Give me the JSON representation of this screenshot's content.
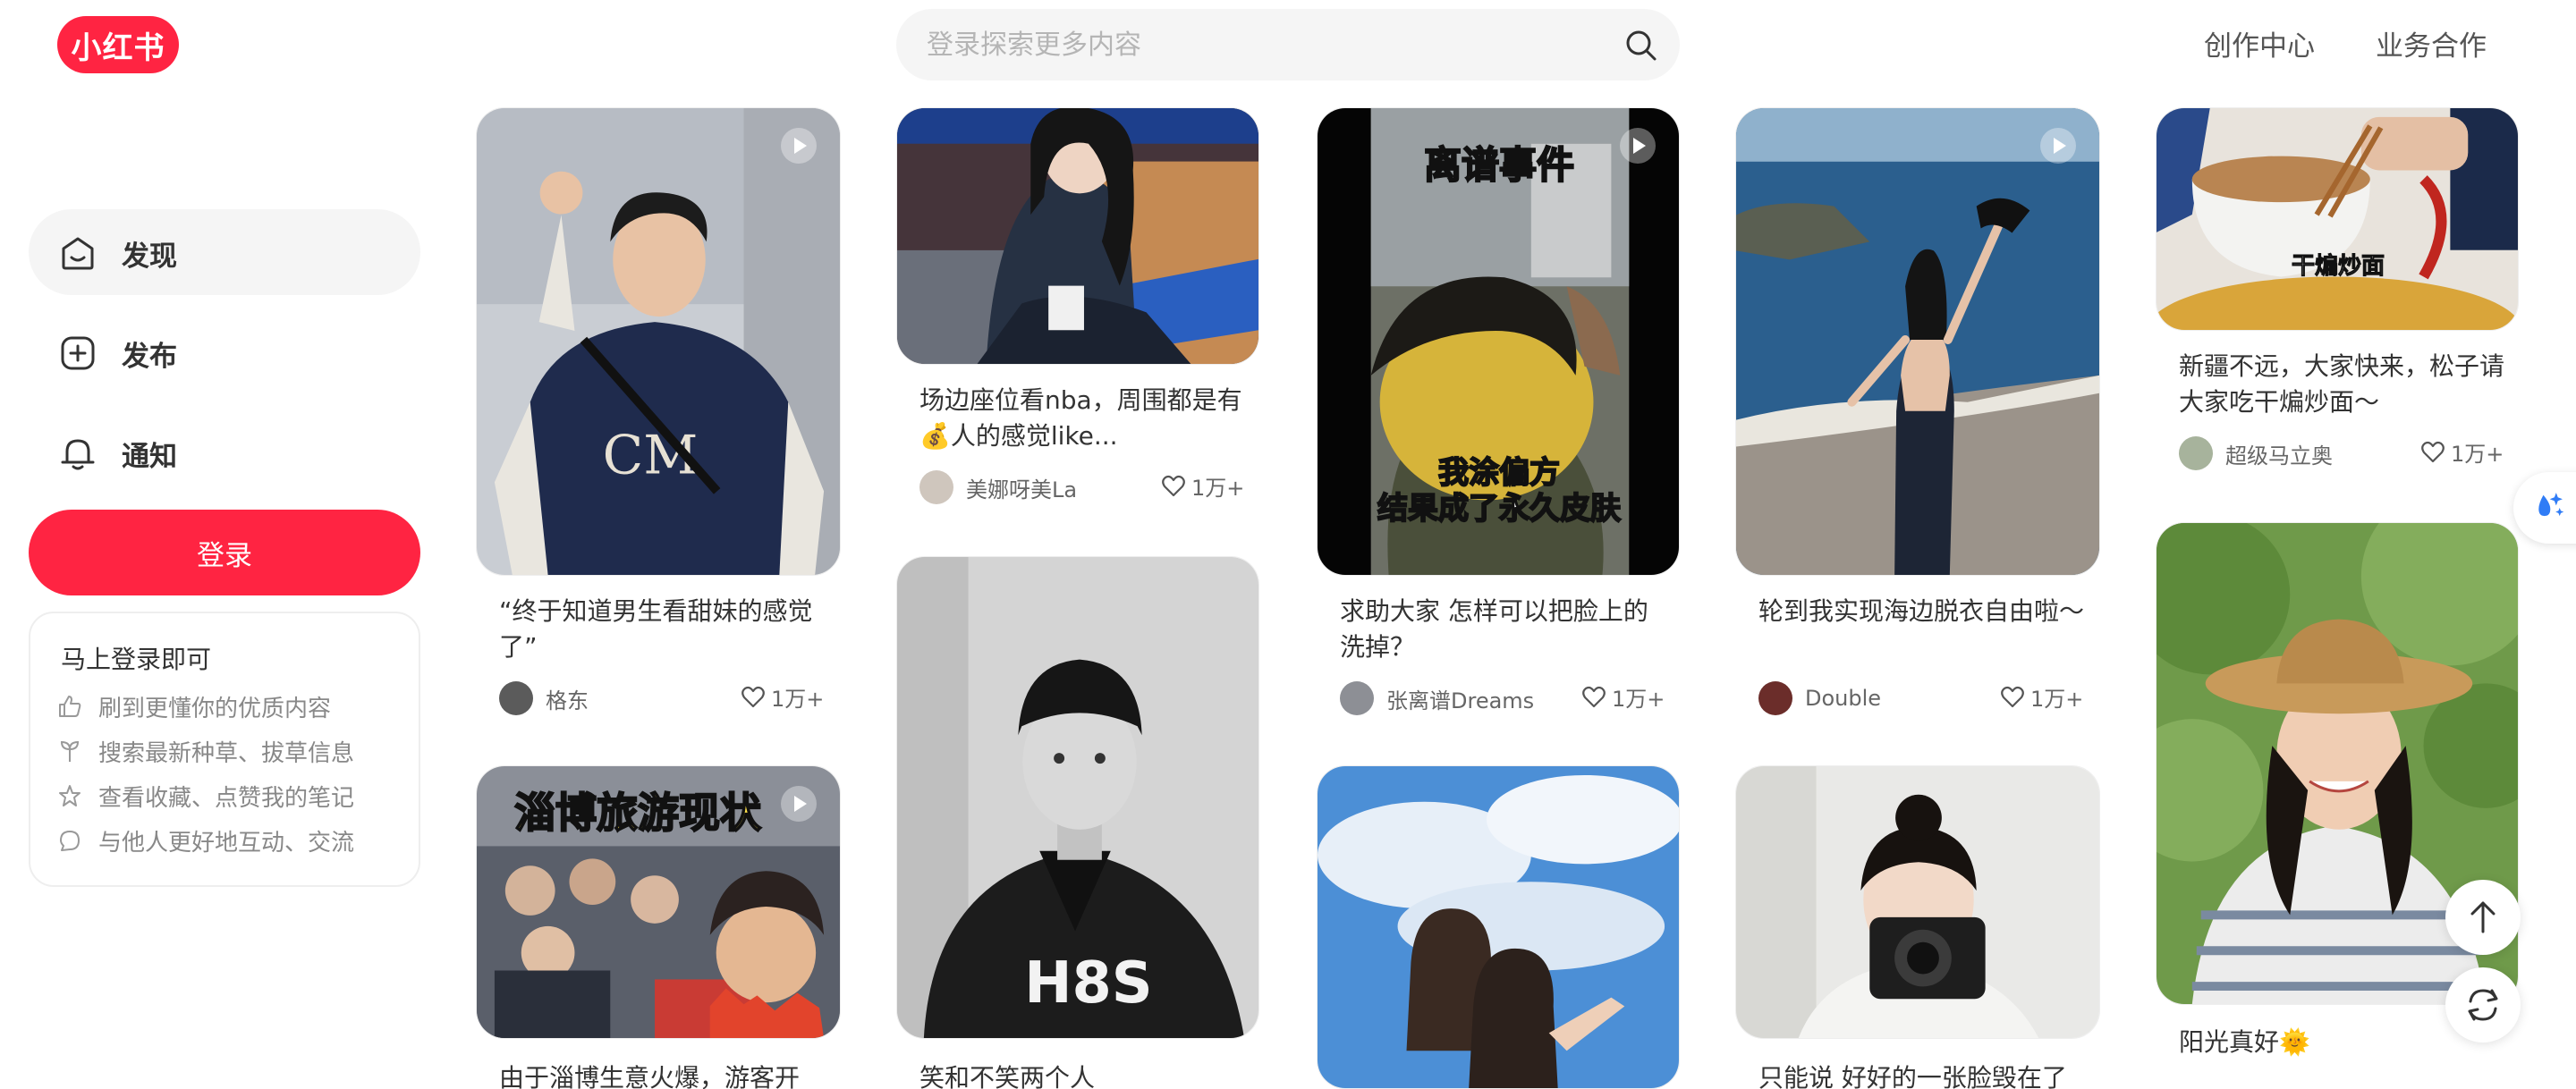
{
  "header": {
    "logo_text": "小红书",
    "search_placeholder": "登录探索更多内容",
    "links": [
      "创作中心",
      "业务合作"
    ]
  },
  "sidebar": {
    "items": [
      {
        "label": "发现",
        "icon": "home-icon",
        "active": true
      },
      {
        "label": "发布",
        "icon": "plus-square-icon",
        "active": false
      },
      {
        "label": "通知",
        "icon": "bell-icon",
        "active": false
      }
    ],
    "login_label": "登录",
    "promo": {
      "title": "马上登录即可",
      "items": [
        {
          "icon": "thumb-up-icon",
          "text": "刷到更懂你的优质内容"
        },
        {
          "icon": "sprout-icon",
          "text": "搜索最新种草、拔草信息"
        },
        {
          "icon": "star-icon",
          "text": "查看收藏、点赞我的笔记"
        },
        {
          "icon": "chat-icon",
          "text": "与他人更好地互动、交流"
        }
      ]
    }
  },
  "feed": {
    "cards": [
      {
        "title": "“终于知道男生看甜妹的感觉了”",
        "author": "格东",
        "likes": "1万+",
        "video": true
      },
      {
        "title": "场边座位看nba，周围都是有💰人的感觉like...",
        "author": "美娜呀美La",
        "likes": "1万+",
        "video": false
      },
      {
        "title": "求助大家 怎样可以把脸上的洗掉？",
        "author": "张离谱Dreams",
        "likes": "1万+",
        "video": true,
        "overlay_top": "离谱事件",
        "overlay_bottom_1": "我涂偏方",
        "overlay_bottom_2": "结果成了永久皮肤"
      },
      {
        "title": "轮到我实现海边脱衣自由啦～",
        "author": "Double",
        "likes": "1万+",
        "video": true
      },
      {
        "title": "新疆不远，大家快来，松子请大家吃干煸炒面～",
        "author": "超级马立奥",
        "likes": "1万+",
        "video": false,
        "overlay": "干煸炒面"
      },
      {
        "title": "由于淄博生意火爆，游客开",
        "overlay": "淄博旅游现状",
        "video": true
      },
      {
        "title": "笑和不笑两个人",
        "video": false
      },
      {
        "title": "",
        "video": false
      },
      {
        "title": "只能说 好好的一张脸毁在了",
        "video": false
      },
      {
        "title": "阳光真好🌞",
        "video": false
      }
    ]
  },
  "colors": {
    "brand": "#ff2442",
    "nav_active_bg": "#f5f5f5"
  }
}
